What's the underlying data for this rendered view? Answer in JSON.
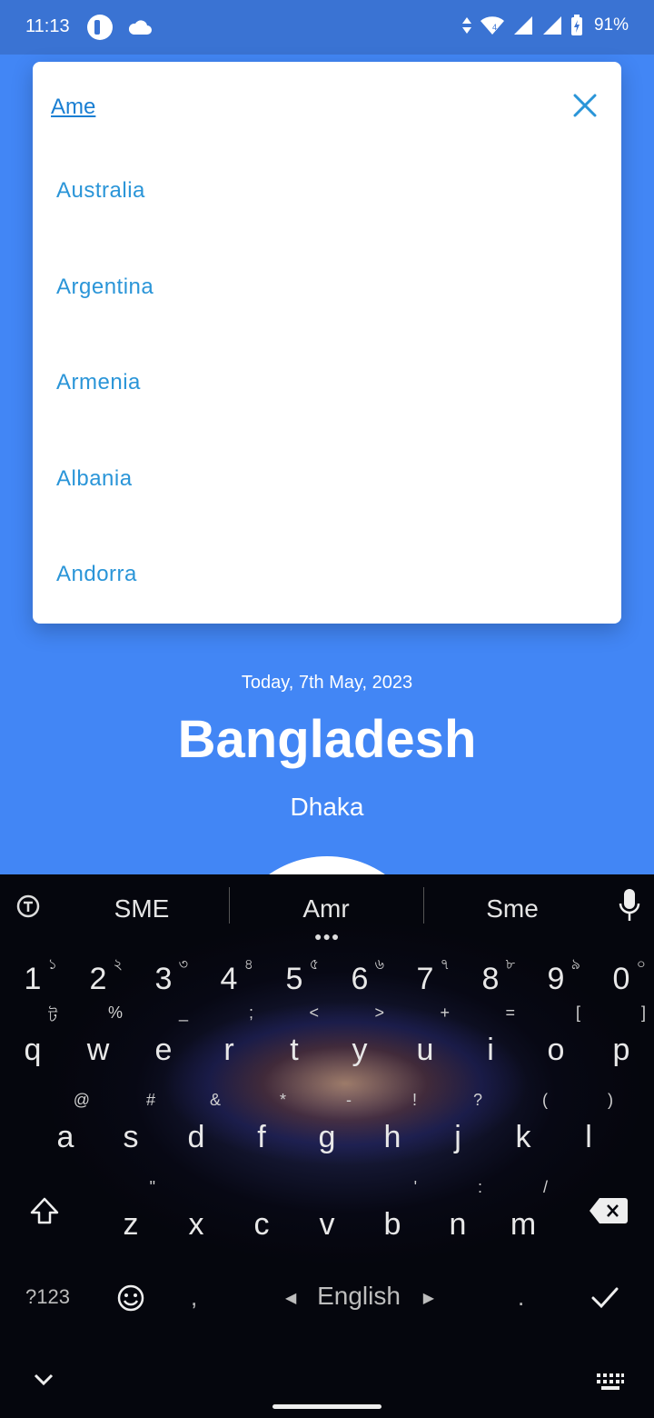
{
  "status_bar": {
    "time": "11:13",
    "battery_pct": "91%"
  },
  "dropdown": {
    "query": "Ame",
    "items": [
      "Australia",
      "Argentina",
      "Armenia",
      "Albania",
      "Andorra"
    ]
  },
  "main": {
    "date": "Today, 7th May, 2023",
    "country": "Bangladesh",
    "city": "Dhaka"
  },
  "keyboard": {
    "suggestions": [
      "SME",
      "Amr",
      "Sme"
    ],
    "number_row": [
      {
        "m": "1",
        "s": "১"
      },
      {
        "m": "2",
        "s": "২"
      },
      {
        "m": "3",
        "s": "৩"
      },
      {
        "m": "4",
        "s": "৪"
      },
      {
        "m": "5",
        "s": "৫"
      },
      {
        "m": "6",
        "s": "৬"
      },
      {
        "m": "7",
        "s": "৭"
      },
      {
        "m": "8",
        "s": "৮"
      },
      {
        "m": "9",
        "s": "৯"
      },
      {
        "m": "0",
        "s": "০"
      }
    ],
    "row1": [
      {
        "m": "q",
        "s": "ট"
      },
      {
        "m": "w",
        "s": "%"
      },
      {
        "m": "e",
        "s": "_"
      },
      {
        "m": "r",
        "s": ";"
      },
      {
        "m": "t",
        "s": "<"
      },
      {
        "m": "y",
        "s": ">"
      },
      {
        "m": "u",
        "s": "+"
      },
      {
        "m": "i",
        "s": "="
      },
      {
        "m": "o",
        "s": "["
      },
      {
        "m": "p",
        "s": "]"
      }
    ],
    "row2": [
      {
        "m": "a",
        "s": "@"
      },
      {
        "m": "s",
        "s": "#"
      },
      {
        "m": "d",
        "s": "&"
      },
      {
        "m": "f",
        "s": "*"
      },
      {
        "m": "g",
        "s": "-"
      },
      {
        "m": "h",
        "s": "!"
      },
      {
        "m": "j",
        "s": "?"
      },
      {
        "m": "k",
        "s": "("
      },
      {
        "m": "l",
        "s": ")"
      }
    ],
    "row3": [
      {
        "m": "z",
        "s": "\""
      },
      {
        "m": "x",
        "s": ""
      },
      {
        "m": "c",
        "s": ""
      },
      {
        "m": "v",
        "s": ""
      },
      {
        "m": "b",
        "s": "'"
      },
      {
        "m": "n",
        "s": ":"
      },
      {
        "m": "m",
        "s": "/"
      }
    ],
    "symbols_key": "?123",
    "comma": ",",
    "language": "English",
    "period": "."
  },
  "colors": {
    "app_background": "#4286f5",
    "status_bar": "#3a73d3",
    "link_blue": "#2a95d8"
  }
}
